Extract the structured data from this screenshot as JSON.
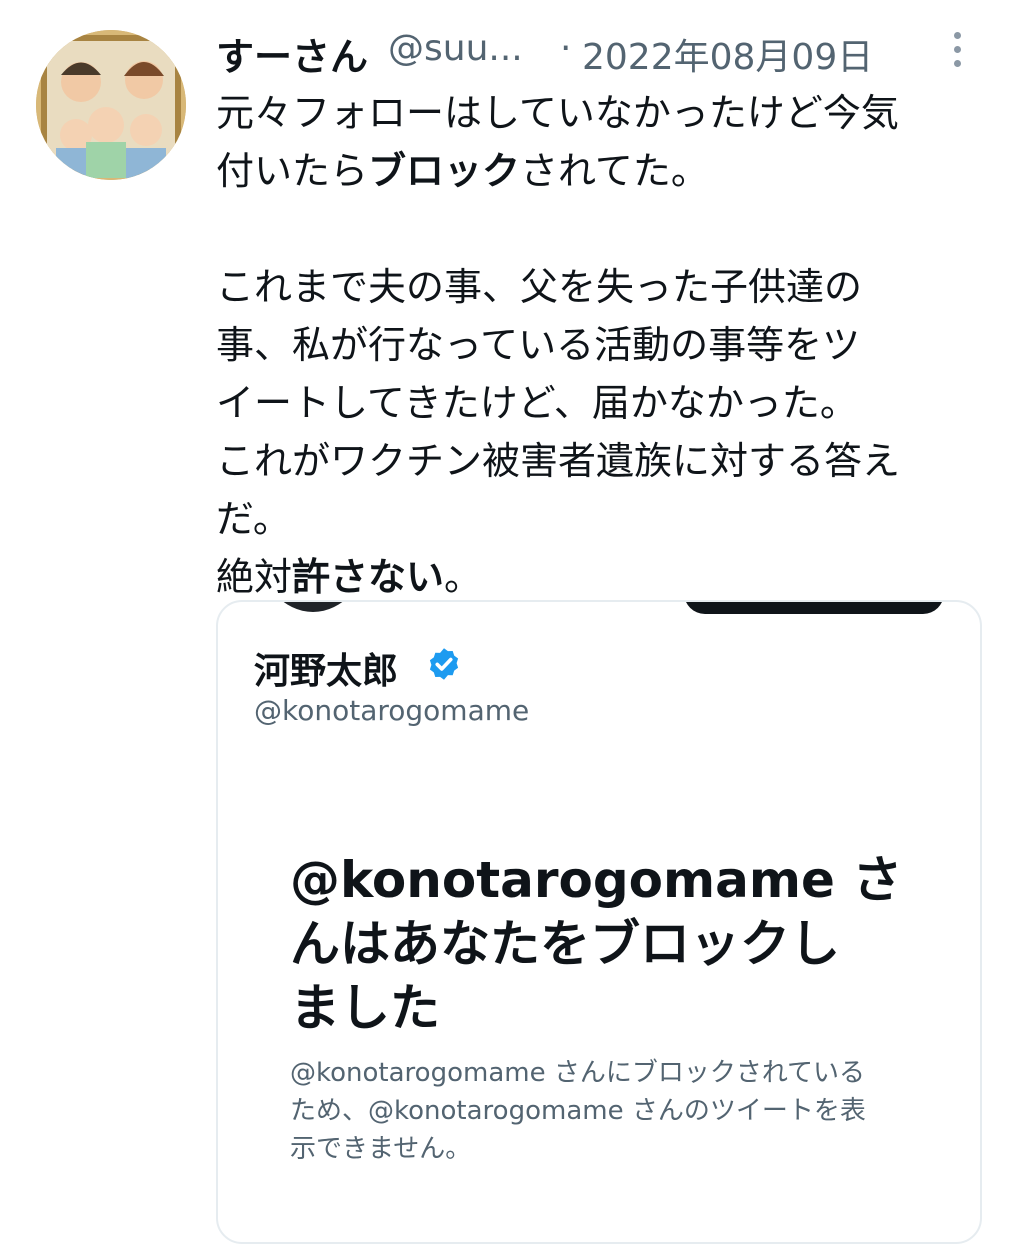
{
  "tweet": {
    "display_name": "すーさん",
    "handle": "@suu...",
    "separator": "·",
    "date": "2022年08月09日",
    "more_icon": "more-vertical-icon",
    "body_lines": [
      {
        "pre": "元々フォローはしていなかったけど今気",
        "bold": "",
        "post": ""
      },
      {
        "pre": "付いたら",
        "bold": "ブロック",
        "post": "されてた。"
      },
      {
        "pre": "",
        "bold": "",
        "post": ""
      },
      {
        "pre": "これまで夫の事、父を失った子供達の",
        "bold": "",
        "post": ""
      },
      {
        "pre": "事、私が行なっている活動の事等をツ",
        "bold": "",
        "post": ""
      },
      {
        "pre": "イートしてきたけど、届かなかった。",
        "bold": "",
        "post": ""
      },
      {
        "pre": "これがワクチン被害者遺族に対する答え",
        "bold": "",
        "post": ""
      },
      {
        "pre": "だ。",
        "bold": "",
        "post": ""
      },
      {
        "pre": "絶対",
        "bold": "許さない",
        "post": "。"
      }
    ]
  },
  "embedded_profile": {
    "name": "河野太郎",
    "verified_icon": "verified-badge-icon",
    "handle": "@konotarogomame",
    "blocked_title_lines": [
      "@konotarogomame さ",
      "んはあなたをブロックし",
      "ました"
    ],
    "blocked_desc_lines": [
      "@konotarogomame さんにブロックされている",
      "ため、@konotarogomame さんのツイートを表",
      "示できません。"
    ]
  },
  "colors": {
    "text": "#0f1419",
    "secondary": "#536471",
    "verified": "#1d9bf0",
    "border": "#e6ecf0"
  }
}
